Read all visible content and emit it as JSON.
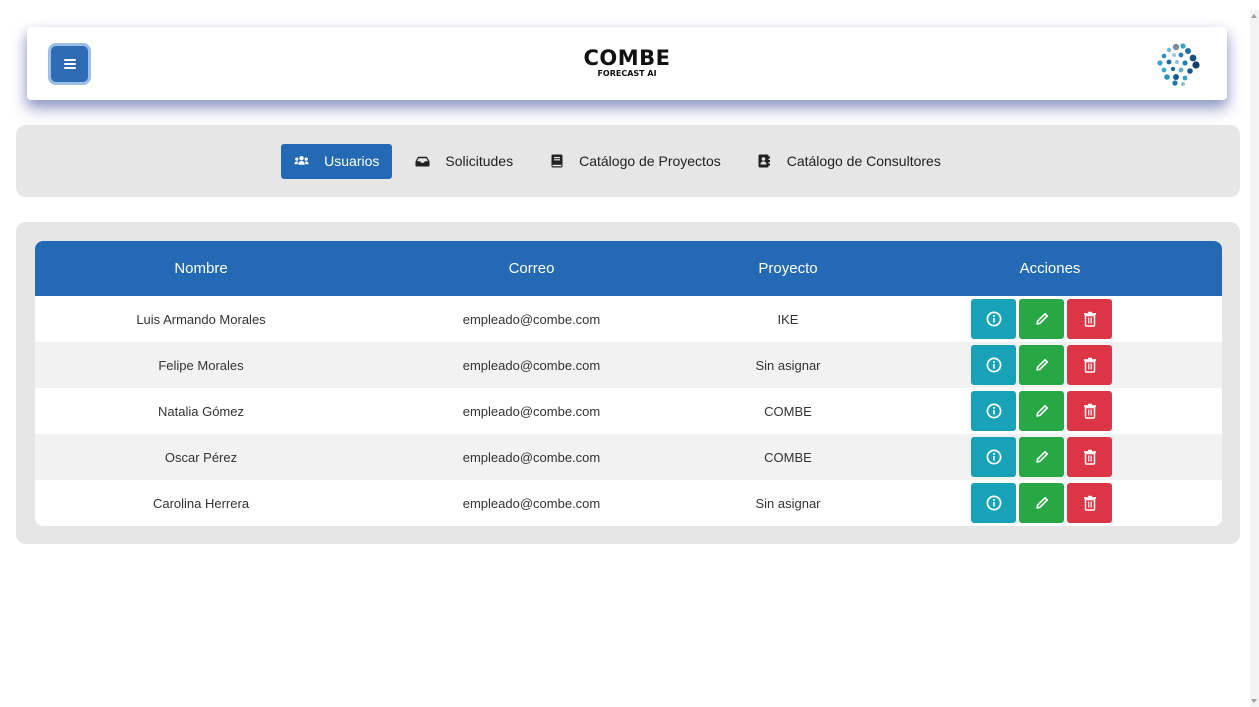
{
  "header": {
    "title": "COMBE",
    "subtitle": "FORECAST AI",
    "menu_icon": "hamburger-icon",
    "logo_icon": "dots-network-logo",
    "brand_color": "#2e6cb6"
  },
  "nav": {
    "items": [
      {
        "label": "Usuarios",
        "icon": "users-icon",
        "active": true
      },
      {
        "label": "Solicitudes",
        "icon": "inbox-icon",
        "active": false
      },
      {
        "label": "Catálogo de Proyectos",
        "icon": "book-icon",
        "active": false
      },
      {
        "label": "Catálogo de Consultores",
        "icon": "address-book-icon",
        "active": false
      }
    ]
  },
  "table": {
    "columns": [
      "Nombre",
      "Correo",
      "Proyecto",
      "Acciones"
    ],
    "rows": [
      {
        "nombre": "Luis Armando Morales",
        "correo": "empleado@combe.com",
        "proyecto": "IKE"
      },
      {
        "nombre": "Felipe Morales",
        "correo": "empleado@combe.com",
        "proyecto": "Sin asignar"
      },
      {
        "nombre": "Natalia Gómez",
        "correo": "empleado@combe.com",
        "proyecto": "COMBE"
      },
      {
        "nombre": "Oscar Pérez",
        "correo": "empleado@combe.com",
        "proyecto": "COMBE"
      },
      {
        "nombre": "Carolina Herrera",
        "correo": "empleado@combe.com",
        "proyecto": "Sin asignar"
      }
    ],
    "action_icons": [
      "info-icon",
      "pencil-icon",
      "trash-icon"
    ],
    "action_colors": {
      "info": "#17a2b8",
      "edit": "#28a745",
      "delete": "#dc3545"
    },
    "header_color": "#2469b3"
  }
}
